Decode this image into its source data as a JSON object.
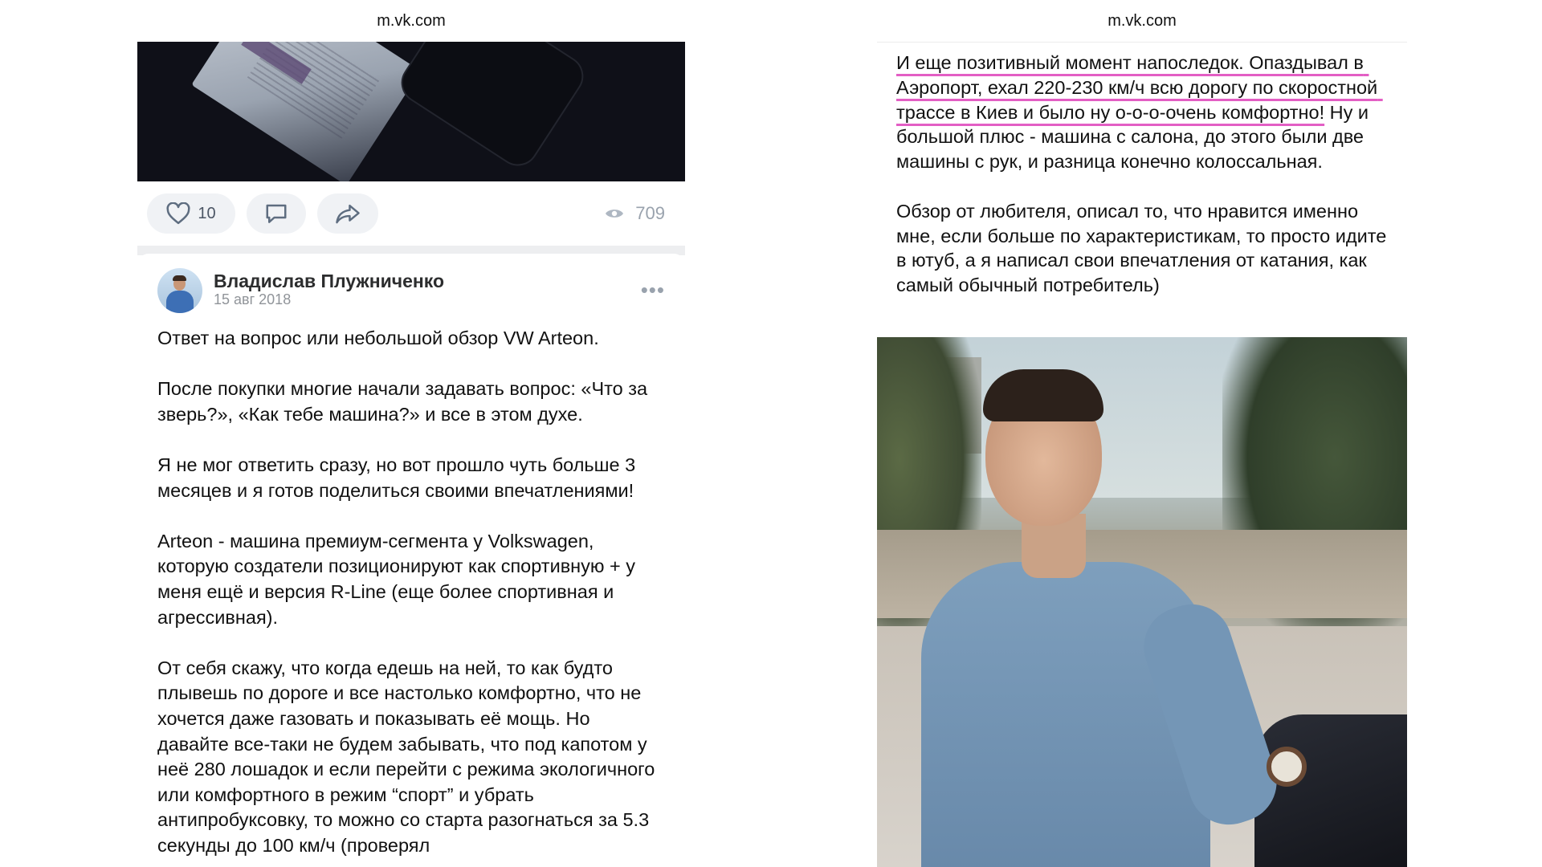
{
  "left_panel": {
    "url": "m.vk.com",
    "actions": {
      "like_count": "10",
      "views_count": "709"
    },
    "post": {
      "author": "Владислав Плужниченко",
      "date": "15 авг 2018",
      "paragraphs": [
        "Ответ на вопрос или небольшой обзор VW Arteon.",
        "После покупки многие начали задавать вопрос: «Что за зверь?», «Как тебе машина?» и все в этом духе.",
        "Я не мог ответить сразу, но вот прошло чуть больше 3 месяцев и я готов поделиться своими впечатлениями!",
        "Arteon - машина премиум-сегмента у Volkswagen, которую создатели позиционируют как спортивную + у меня ещё и версия R-Line (еще более спортивная и агрессивная).",
        "От себя скажу, что когда едешь на ней, то как будто плывешь по дороге и все настолько комфортно, что не хочется даже газовать и показывать её мощь. Но давайте все-таки не будем забывать, что под капотом у неё 280 лошадок и если перейти с режима экологичного или комфортного в режим “спорт” и убрать антипробуксовку, то можно со старта разогнаться за 5.3 секунды до 100 км/ч (проверял"
      ]
    }
  },
  "right_panel": {
    "url": "m.vk.com",
    "highlighted_text": "И еще позитивный момент напоследок. Опаздывал в Аэропорт, ехал 220-230 км/ч всю дорогу по скоростной трассе в Киев и было ну о-о-о-очень комфортно!",
    "continued_text": " Ну и большой плюс - машина с салона, до этого были две машины с рук, и разница конечно колоссальная.",
    "closing_paragraph": "Обзор от любителя, описал то, что нравится именно мне, если больше по характеристикам, то просто идите в ютуб, а я написал свои впечатления от катания, как самый обычный потребитель)"
  },
  "colors": {
    "highlight_underline": "#e35ec4",
    "pill_background": "#f0f2f5",
    "icon_gray": "#5e6d80",
    "secondary_text": "#909499"
  },
  "icons": [
    "heart-icon",
    "comment-icon",
    "share-icon",
    "eye-icon",
    "more-dots-icon"
  ]
}
